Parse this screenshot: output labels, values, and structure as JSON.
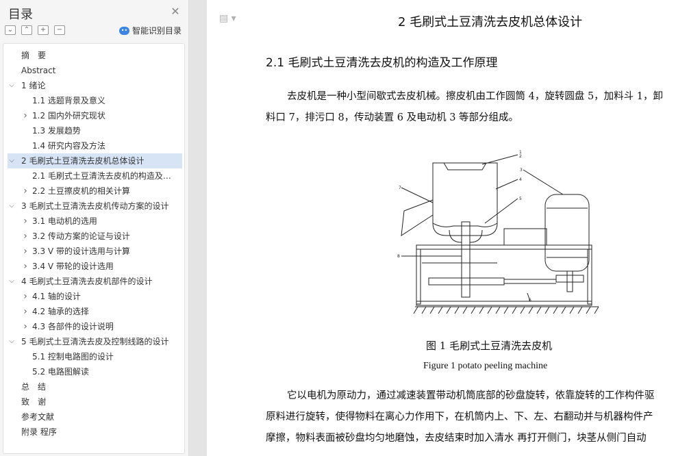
{
  "sidebar": {
    "title": "目录",
    "smart_label": "智能识别目录",
    "items": [
      {
        "label": "摘　要",
        "level": 1,
        "chevron": ""
      },
      {
        "label": "Abstract",
        "level": 1,
        "chevron": ""
      },
      {
        "label": "1 绪论",
        "level": 1,
        "chevron": "down"
      },
      {
        "label": "1.1 选题背景及意义",
        "level": 2,
        "chevron": ""
      },
      {
        "label": "1.2 国内外研究现状",
        "level": 2,
        "chevron": "right"
      },
      {
        "label": "1.3  发展趋势",
        "level": 2,
        "chevron": ""
      },
      {
        "label": "1.4 研究内容及方法",
        "level": 2,
        "chevron": ""
      },
      {
        "label": "2 毛刷式土豆清洗去皮机总体设计",
        "level": 1,
        "chevron": "down",
        "selected": true
      },
      {
        "label": "2.1 毛刷式土豆清洗去皮机的构造及工作原理",
        "level": 2,
        "chevron": ""
      },
      {
        "label": "2.2  土豆擦皮机的相关计算",
        "level": 2,
        "chevron": "right"
      },
      {
        "label": "3 毛刷式土豆清洗去皮机传动方案的设计",
        "level": 1,
        "chevron": "down"
      },
      {
        "label": "3.1 电动机的选用",
        "level": 2,
        "chevron": "right"
      },
      {
        "label": "3.2 传动方案的论证与设计",
        "level": 2,
        "chevron": "right"
      },
      {
        "label": "3.3 V 带的设计选用与计算",
        "level": 2,
        "chevron": "right"
      },
      {
        "label": "3.4 V 带轮的设计选用",
        "level": 2,
        "chevron": "right"
      },
      {
        "label": "4 毛刷式土豆清洗去皮机部件的设计",
        "level": 1,
        "chevron": "down"
      },
      {
        "label": "4.1 轴的设计",
        "level": 2,
        "chevron": "right"
      },
      {
        "label": "4.2 轴承的选择",
        "level": 2,
        "chevron": "right"
      },
      {
        "label": "4.3 各部件的设计说明",
        "level": 2,
        "chevron": "right"
      },
      {
        "label": "5 毛刷式土豆清洗去皮及控制线路的设计",
        "level": 1,
        "chevron": "down"
      },
      {
        "label": "5.1 控制电路图的设计",
        "level": 2,
        "chevron": ""
      },
      {
        "label": "5.2 电路图解读",
        "level": 2,
        "chevron": ""
      },
      {
        "label": "总　结",
        "level": 1,
        "chevron": ""
      },
      {
        "label": "致　谢",
        "level": 1,
        "chevron": ""
      },
      {
        "label": "参考文献",
        "level": 1,
        "chevron": ""
      },
      {
        "label": "附录  程序",
        "level": 1,
        "chevron": ""
      }
    ]
  },
  "doc": {
    "chapter_title": "2 毛刷式土豆清洗去皮机总体设计",
    "section_title": "2.1 毛刷式土豆清洗去皮机的构造及工作原理",
    "para1_line1": "去皮机是一种小型间歇式去皮机械。擦皮机由工作圆筒 4，旋转圆盘 5，加料斗 1，卸",
    "para1_line2": "料口 7，排污口 8，传动装置 6 及电动机 3 等部分组成。",
    "figure_caption_cn": "图 1  毛刷式土豆清洗去皮机",
    "figure_caption_en": "Figure 1 potato peeling machine",
    "para2_line1": "它以电机为原动力，通过减速装置带动机筒底部的砂盘旋转，依靠旋转的工作构件驱",
    "para2_line2": "原料进行旋转，使得物料在离心力作用下，在机筒内上、下、左、右翻动并与机器构件产",
    "para2_line3": "摩擦，物料表面被砂盘均匀地磨蚀，去皮结束时加入清水 再打开侧门，块茎从侧门自动",
    "figure_labels": [
      "1",
      "2",
      "3",
      "4",
      "5",
      "6",
      "7",
      "8"
    ]
  },
  "icons": {
    "close": "close-icon",
    "expand_all": "expand-all-icon",
    "collapse_all": "collapse-all-icon",
    "add": "add-icon",
    "remove": "remove-icon",
    "smart": "smart-toc-icon",
    "doc": "document-icon"
  },
  "colors": {
    "selected_bg": "#d7e4f6",
    "accent": "#3a85e6"
  }
}
